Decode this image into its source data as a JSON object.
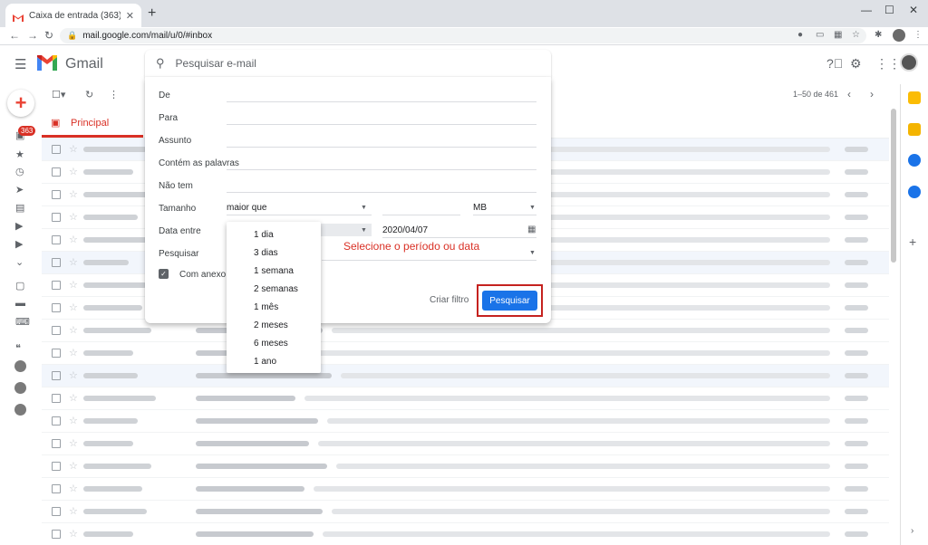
{
  "browser": {
    "tab_title": "Caixa de entrada (363) - ",
    "tab_close": "✕",
    "new_tab": "+",
    "url": "mail.google.com/mail/u/0/#inbox"
  },
  "gmail": {
    "logo_text": "Gmail",
    "search_placeholder": "Pesquisar e-mail",
    "unread_badge": "363",
    "range_label": "1–50 de 461",
    "tab_principal": "Principal"
  },
  "advanced_search": {
    "labels": {
      "from": "De",
      "to": "Para",
      "subject": "Assunto",
      "has_words": "Contém as palavras",
      "doesnt_have": "Não tem",
      "size": "Tamanho",
      "date_within": "Data entre",
      "search_in": "Pesquisar"
    },
    "size_operator": "maior que",
    "size_unit": "MB",
    "date_value": "2020/04/07",
    "has_attachment_label": "Com anexo",
    "create_filter_label": "Criar filtro",
    "search_button_label": "Pesquisar",
    "annotation": "Selecione o período ou data"
  },
  "date_dropdown": {
    "options": [
      "1 dia",
      "3 dias",
      "1 semana",
      "2 semanas",
      "1 mês",
      "2 meses",
      "6 meses",
      "1 ano"
    ]
  },
  "colors": {
    "accent_red": "#d93025",
    "primary_blue": "#1a73e8",
    "highlight_box": "#c5221f"
  },
  "icons": {
    "search": "search-icon",
    "menu": "hamburger-menu-icon",
    "help": "help-icon",
    "settings": "gear-icon",
    "apps": "apps-grid-icon",
    "calendar": "calendar-icon"
  }
}
